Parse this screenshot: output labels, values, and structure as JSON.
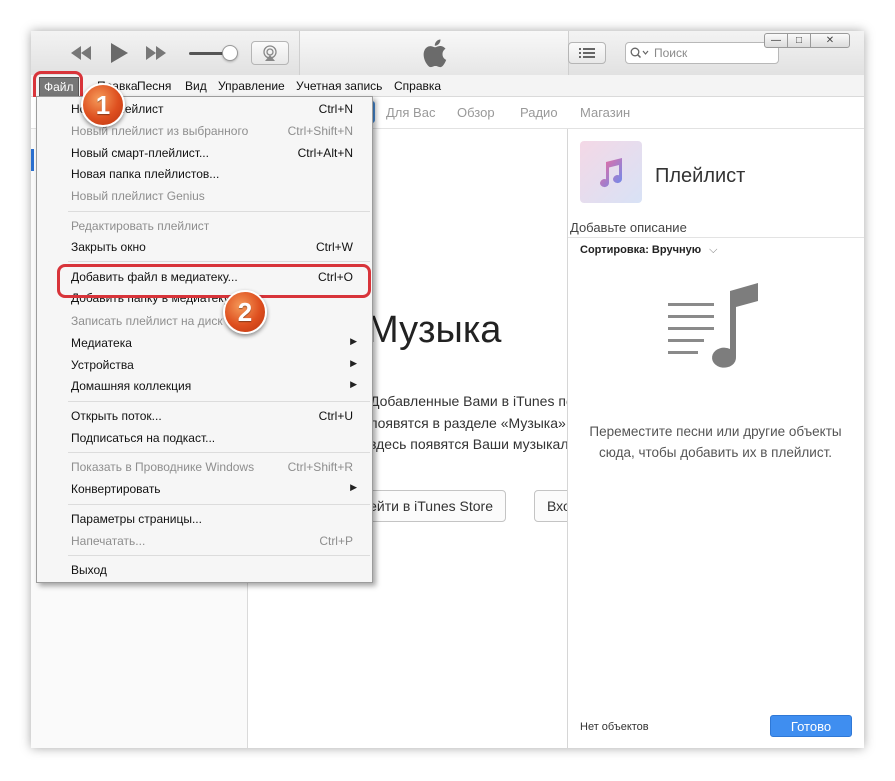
{
  "toolbar": {
    "search_placeholder": "Поиск",
    "close_glyph": "✕",
    "minimize_glyph": "—",
    "maximize_glyph": "□"
  },
  "menubar": {
    "file": "Файл",
    "edit": "Правка",
    "song": "Песня",
    "view": "Вид",
    "controls": "Управление",
    "account": "Учетная запись",
    "help": "Справка"
  },
  "nav": {
    "for_you": "Для Вас",
    "browse": "Обзор",
    "radio": "Радио",
    "store": "Магазин"
  },
  "main": {
    "heading": "Музыка",
    "text1": "Добавленные Вами в iTunes песни и видеоклипы",
    "text2": "появятся в разделе «Музыка». После входа в iTunes Store",
    "text3": "здесь появятся Ваши музыкальные покупки, хранящиеся в iCloud.",
    "btn_store": "Перейти в iTunes Store",
    "btn_login": "Вход в iTunes Store"
  },
  "playlist": {
    "title": "Плейлист",
    "description": "Добавьте описание",
    "sort": "Сортировка: Вручную",
    "empty_text": "Переместите песни или другие объекты сюда, чтобы добавить их в плейлист.",
    "count": "Нет объектов",
    "done": "Готово"
  },
  "file_menu": {
    "items": [
      {
        "label": "Новый плейлист",
        "shortcut": "Ctrl+N",
        "disabled": false
      },
      {
        "label": "Новый плейлист из выбранного",
        "shortcut": "Ctrl+Shift+N",
        "disabled": true
      },
      {
        "label": "Новый смарт-плейлист...",
        "shortcut": "Ctrl+Alt+N",
        "disabled": false
      },
      {
        "label": "Новая папка плейлистов...",
        "shortcut": "",
        "disabled": false
      },
      {
        "label": "Новый плейлист Genius",
        "shortcut": "",
        "disabled": true
      },
      {
        "label": "Редактировать плейлист",
        "shortcut": "",
        "disabled": true
      },
      {
        "label": "Закрыть окно",
        "shortcut": "Ctrl+W",
        "disabled": false
      },
      {
        "label": "Добавить файл в медиатеку...",
        "shortcut": "Ctrl+O",
        "disabled": false
      },
      {
        "label": "Добавить папку в медиатеку...",
        "shortcut": "",
        "disabled": false
      },
      {
        "label": "Записать плейлист на диск",
        "shortcut": "",
        "disabled": true
      },
      {
        "label": "Медиатека",
        "shortcut": "",
        "disabled": false,
        "submenu": true
      },
      {
        "label": "Устройства",
        "shortcut": "",
        "disabled": false,
        "submenu": true
      },
      {
        "label": "Домашняя коллекция",
        "shortcut": "",
        "disabled": false,
        "submenu": true
      },
      {
        "label": "Открыть поток...",
        "shortcut": "Ctrl+U",
        "disabled": false
      },
      {
        "label": "Подписаться на подкаст...",
        "shortcut": "",
        "disabled": false
      },
      {
        "label": "Показать в Проводнике Windows",
        "shortcut": "Ctrl+Shift+R",
        "disabled": true
      },
      {
        "label": "Конвертировать",
        "shortcut": "",
        "disabled": false,
        "submenu": true
      },
      {
        "label": "Параметры страницы...",
        "shortcut": "",
        "disabled": false
      },
      {
        "label": "Напечатать...",
        "shortcut": "Ctrl+P",
        "disabled": true
      },
      {
        "label": "Выход",
        "shortcut": "",
        "disabled": false
      }
    ]
  },
  "callouts": {
    "step1": "1",
    "step2": "2"
  },
  "colors": {
    "accent_blue": "#3f8ef0",
    "highlight_red": "#d8343a",
    "badge_orange": "#de4f1f"
  }
}
